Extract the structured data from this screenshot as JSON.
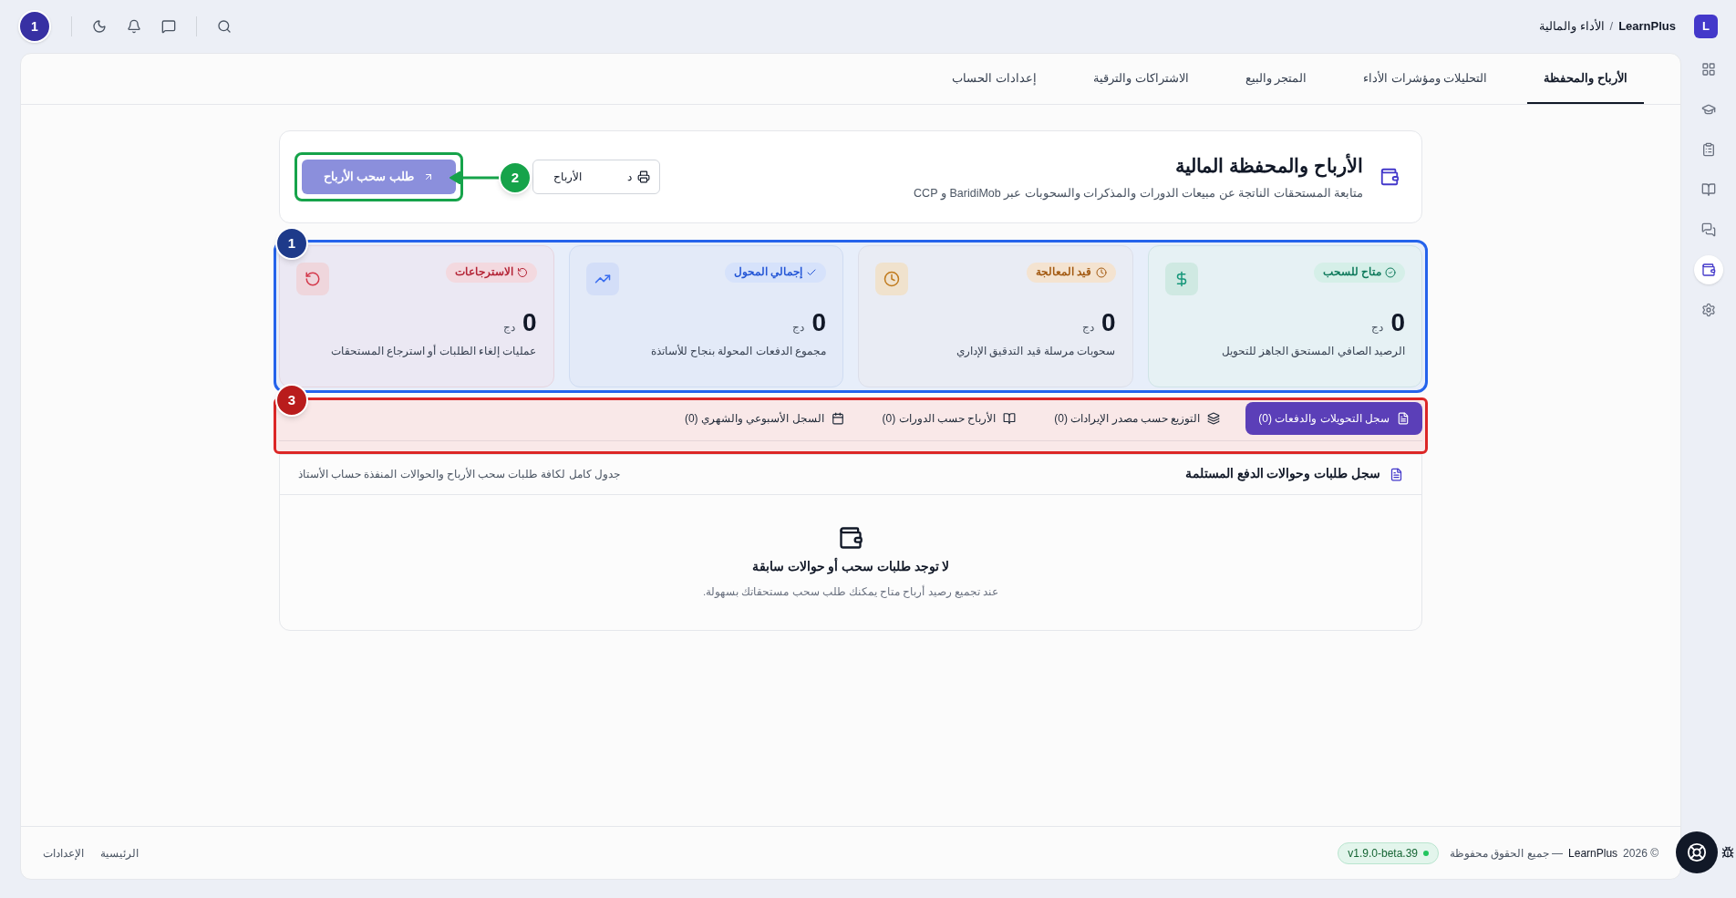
{
  "topbar": {
    "logo": "L",
    "brand": "LearnPlus",
    "separator": "/",
    "page": "الأداء والمالية",
    "avatar": "1"
  },
  "sidebar": {
    "items": [
      {
        "selected": false
      },
      {
        "selected": false
      },
      {
        "selected": false
      },
      {
        "selected": false
      },
      {
        "selected": false
      },
      {
        "selected": true
      },
      {
        "selected": false
      }
    ]
  },
  "tabs": [
    {
      "label": "الأرباح والمحفظة",
      "selected": true
    },
    {
      "label": "التحليلات ومؤشرات الأداء",
      "selected": false
    },
    {
      "label": "المتجر والبيع",
      "selected": false
    },
    {
      "label": "الاشتراكات والترقية",
      "selected": false
    },
    {
      "label": "إعدادات الحساب",
      "selected": false
    }
  ],
  "header": {
    "title": "الأرباح والمحفظة المالية",
    "subtitle": "متابعة المستحقات الناتجة عن مبيعات الدورات والمذكرات والسحوبات عبر BaridiMob و CCP",
    "print_button": {
      "label_start": "د",
      "label_end": "الأرباح"
    },
    "withdraw_button": {
      "label": "طلب سحب الأرباح",
      "disabled": true
    }
  },
  "stats": [
    {
      "kind": "green",
      "badge": "متاح للسحب",
      "amount": "0",
      "currency": "دج",
      "description": "الرصيد الصافي المستحق الجاهز للتحويل"
    },
    {
      "kind": "amber",
      "badge": "قيد المعالجة",
      "amount": "0",
      "currency": "دج",
      "description": "سحوبات مرسلة قيد التدقيق الإداري"
    },
    {
      "kind": "blue",
      "badge": "إجمالي المحول",
      "amount": "0",
      "currency": "دج",
      "description": "مجموع الدفعات المحولة بنجاح للأساتذة"
    },
    {
      "kind": "red",
      "badge": "الاسترجاعات",
      "amount": "0",
      "currency": "دج",
      "description": "عمليات إلغاء الطلبات أو استرجاع المستحقات"
    }
  ],
  "section_tabs": [
    {
      "label": "سجل التحويلات والدفعات (0)",
      "selected": true
    },
    {
      "label": "التوزيع حسب مصدر الإيرادات (0)",
      "selected": false
    },
    {
      "label": "الأرباح حسب الدورات (0)",
      "selected": false
    },
    {
      "label": "السجل الأسبوعي والشهري (0)",
      "selected": false
    }
  ],
  "table": {
    "title": "سجل طلبات وحوالات الدفع المستلمة",
    "subtitle": "جدول كامل لكافة طلبات سحب الأرباح والحوالات المنفذة حساب الأستاذ",
    "empty_title": "لا توجد طلبات سحب أو حوالات سابقة",
    "empty_text": "عند تجميع رصيد أرباح متاح يمكنك طلب سحب مستحقاتك بسهولة."
  },
  "footer": {
    "copyright": "© 2026",
    "brand": "LearnPlus",
    "rights": "— جميع الحقوق محفوظة",
    "version": "v1.9.0-beta.39",
    "links": [
      "الرئيسية",
      "الإعدادات"
    ]
  },
  "annotations": [
    {
      "number": "1",
      "color": "#2563eb"
    },
    {
      "number": "2",
      "color": "#16a34a"
    },
    {
      "number": "3",
      "color": "#dc2626"
    }
  ]
}
